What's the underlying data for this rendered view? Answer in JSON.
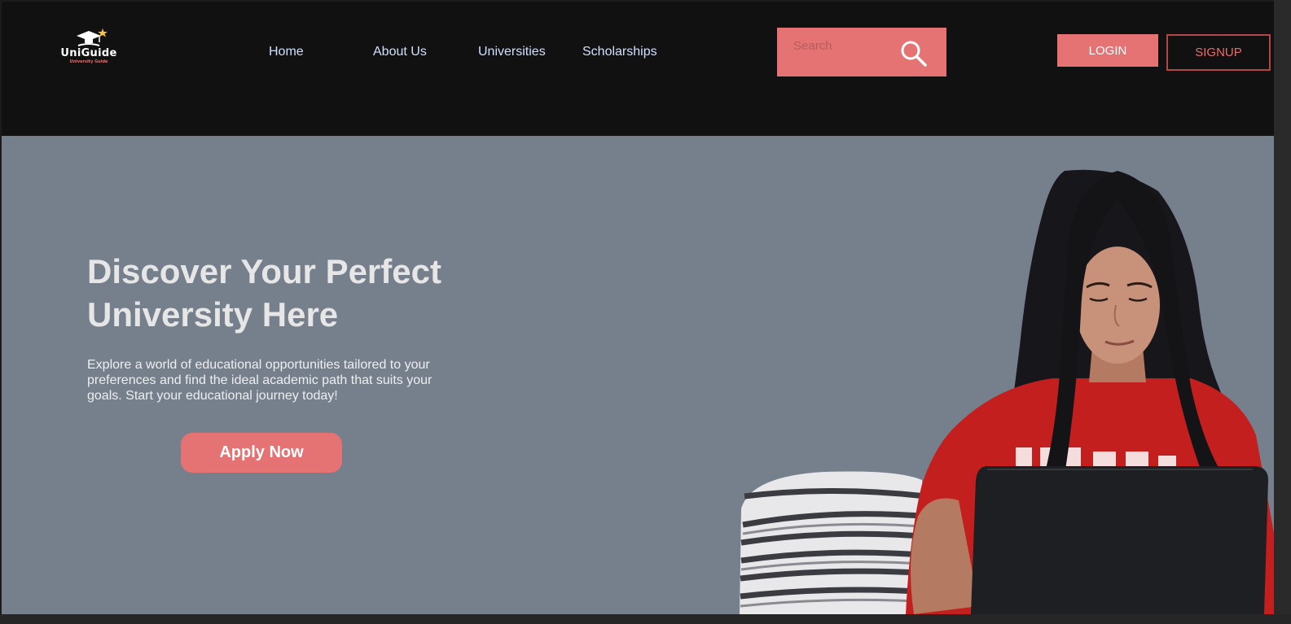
{
  "brand": {
    "name": "UniGuide",
    "tagline": "University Guide"
  },
  "nav": {
    "items": [
      {
        "label": "Home"
      },
      {
        "label": "About Us"
      },
      {
        "label": "Universities"
      },
      {
        "label": "Scholarships"
      }
    ]
  },
  "search": {
    "placeholder": "Search",
    "icon": "search-icon"
  },
  "auth": {
    "login_label": "LOGIN",
    "signup_label": "SIGNUP"
  },
  "hero": {
    "title": "Discover Your Perfect University Here",
    "description": "Explore a world of educational opportunities tailored to your preferences and find the ideal academic path that suits your goals. Start your educational journey today!",
    "cta_label": "Apply Now"
  },
  "colors": {
    "header_bg": "#111111",
    "hero_bg": "#76808c",
    "accent": "#e57373",
    "nav_text": "#cfe0ff",
    "signup_border": "#b34646"
  }
}
